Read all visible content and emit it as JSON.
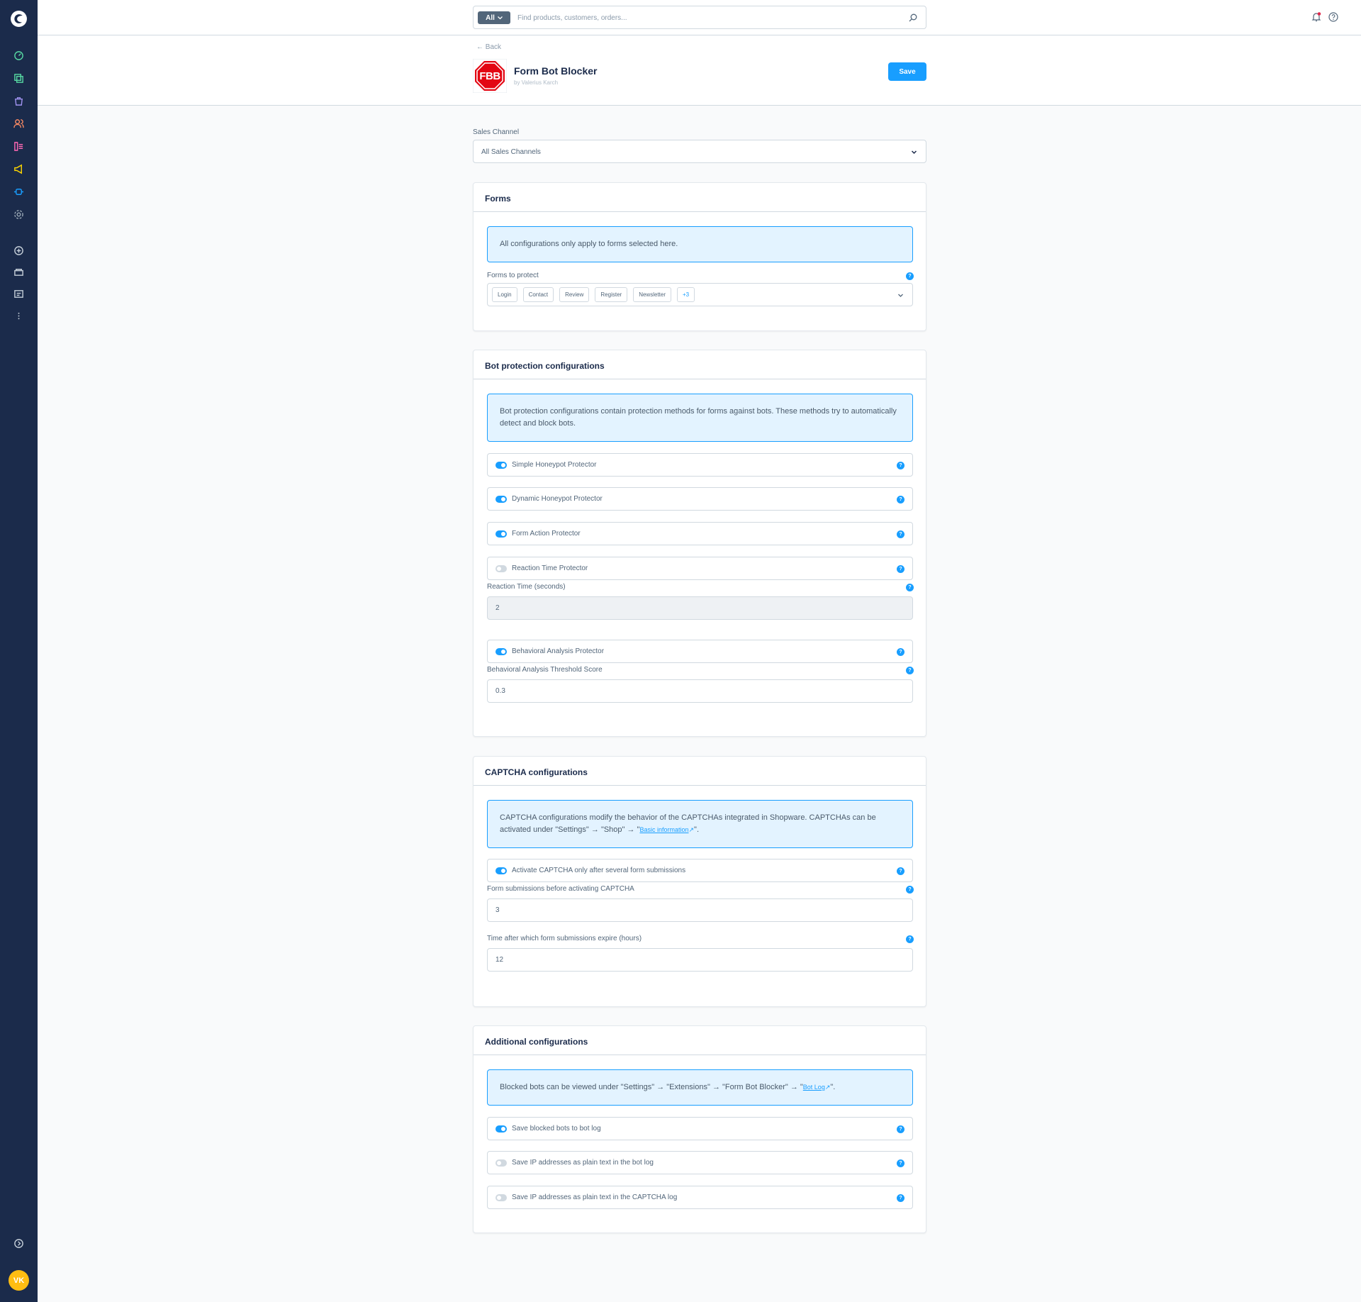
{
  "search": {
    "type_label": "All",
    "placeholder": "Find products, customers, orders..."
  },
  "header": {
    "back_label": "Back",
    "extension_title": "Form Bot Blocker",
    "author": "by Valerius Karch",
    "save_label": "Save",
    "logo_text": "FBB"
  },
  "sales_channel": {
    "label": "Sales Channel",
    "value": "All Sales Channels"
  },
  "forms_card": {
    "title": "Forms",
    "info": "All configurations only apply to forms selected here.",
    "field_label": "Forms to protect",
    "tags": [
      "Login",
      "Contact",
      "Review",
      "Register",
      "Newsletter",
      "+3"
    ]
  },
  "bot_card": {
    "title": "Bot protection configurations",
    "info": "Bot protection configurations contain protection methods for forms against bots. These methods try to automatically detect and block bots.",
    "switches": [
      {
        "label": "Simple Honeypot Protector",
        "on": true
      },
      {
        "label": "Dynamic Honeypot Protector",
        "on": true
      },
      {
        "label": "Form Action Protector",
        "on": true
      },
      {
        "label": "Reaction Time Protector",
        "on": false
      },
      {
        "label": "Behavioral Analysis Protector",
        "on": true
      }
    ],
    "reaction_label": "Reaction Time (seconds)",
    "reaction_value": "2",
    "behavior_label": "Behavioral Analysis Threshold Score",
    "behavior_value": "0.3"
  },
  "captcha_card": {
    "title": "CAPTCHA configurations",
    "info_text": "CAPTCHA configurations modify the behavior of the CAPTCHAs integrated in Shopware. CAPTCHAs can be activated under \"Settings\" → \"Shop\" → \"",
    "info_link": "Basic information",
    "info_end": "\".",
    "switch_label": "Activate CAPTCHA only after several form submissions",
    "submissions_label": "Form submissions before activating CAPTCHA",
    "submissions_value": "3",
    "expire_label": "Time after which form submissions expire (hours)",
    "expire_value": "12"
  },
  "additional_card": {
    "title": "Additional configurations",
    "info_text": "Blocked bots can be viewed under \"Settings\" → \"Extensions\" → \"Form Bot Blocker\" → \"",
    "info_link": "Bot Log",
    "info_end": "\".",
    "switches": [
      {
        "label": "Save blocked bots to bot log",
        "on": true
      },
      {
        "label": "Save IP addresses as plain text in the bot log",
        "on": false
      },
      {
        "label": "Save IP addresses as plain text in the CAPTCHA log",
        "on": false
      }
    ]
  },
  "user": {
    "initials": "VK"
  },
  "help_glyph": "?"
}
